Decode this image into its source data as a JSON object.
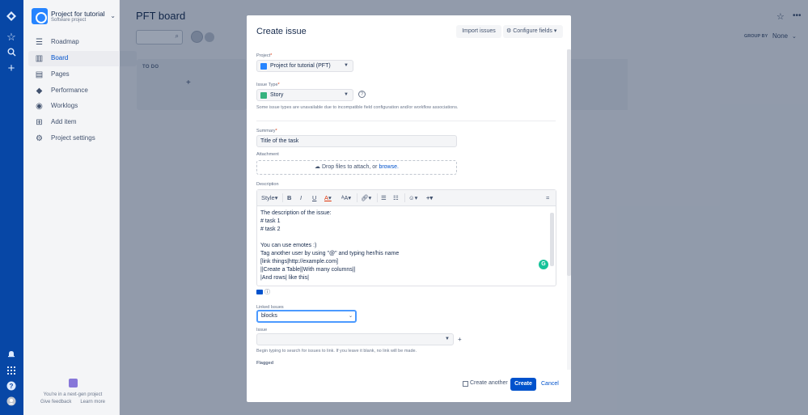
{
  "global_nav": {
    "icons": [
      "jira-logo-icon",
      "star-icon",
      "search-icon",
      "plus-icon",
      "notifications-icon",
      "app-switcher-icon",
      "help-icon",
      "profile-icon"
    ]
  },
  "sidebar": {
    "project_name": "Project for tutorial",
    "project_type": "Software project",
    "items": [
      {
        "label": "Roadmap",
        "icon": "roadmap-icon"
      },
      {
        "label": "Board",
        "icon": "board-icon"
      },
      {
        "label": "Pages",
        "icon": "pages-icon"
      },
      {
        "label": "Performance",
        "icon": "performance-icon"
      },
      {
        "label": "Worklogs",
        "icon": "worklogs-icon"
      },
      {
        "label": "Add item",
        "icon": "add-item-icon"
      },
      {
        "label": "Project settings",
        "icon": "settings-icon"
      }
    ],
    "footer": {
      "text": "You're in a next-gen project",
      "give_feedback": "Give feedback",
      "learn_more": "Learn more"
    }
  },
  "board": {
    "title": "PFT board",
    "columns": [
      {
        "title": "TO DO"
      }
    ],
    "group_by_label": "GROUP BY",
    "group_by_value": "None"
  },
  "modal": {
    "title": "Create issue",
    "import_button": "Import issues",
    "configure_button": "Configure fields",
    "project": {
      "label": "Project",
      "value": "Project for tutorial (PFT)"
    },
    "issue_type": {
      "label": "Issue Type",
      "value": "Story",
      "help": "Some issue types are unavailable due to incompatible field configuration and/or workflow associations."
    },
    "summary": {
      "label": "Summary",
      "value": "Title of the task"
    },
    "attachment": {
      "label": "Attachment",
      "drop_text": "Drop files to attach, or",
      "browse": "browse."
    },
    "description": {
      "label": "Description",
      "toolbar": {
        "style": "Style",
        "bold": "B",
        "italic": "I",
        "underline": "U",
        "text_color": "A"
      },
      "lines": [
        "The description of the issue:",
        "# task 1",
        "# task 2",
        "",
        "You can use emotes :)",
        "Tag another user by using \"@\" and typing her/his name",
        "[link things|http://example.com]",
        "||Create a Table||With many columns||",
        "|And rows| like this|"
      ]
    },
    "linked_issues": {
      "label": "Linked Issues",
      "value": "blocks"
    },
    "issue": {
      "label": "Issue",
      "help": "Begin typing to search for issues to link. If you leave it blank, no link will be made."
    },
    "flagged": {
      "label": "Flagged"
    },
    "footer": {
      "create_another": "Create another",
      "create": "Create",
      "cancel": "Cancel"
    }
  },
  "colors": {
    "nav_bg": "#0747a6",
    "primary": "#0052cc",
    "focus": "#4c9aff",
    "story_icon": "#36b37e",
    "required": "#de350b"
  }
}
